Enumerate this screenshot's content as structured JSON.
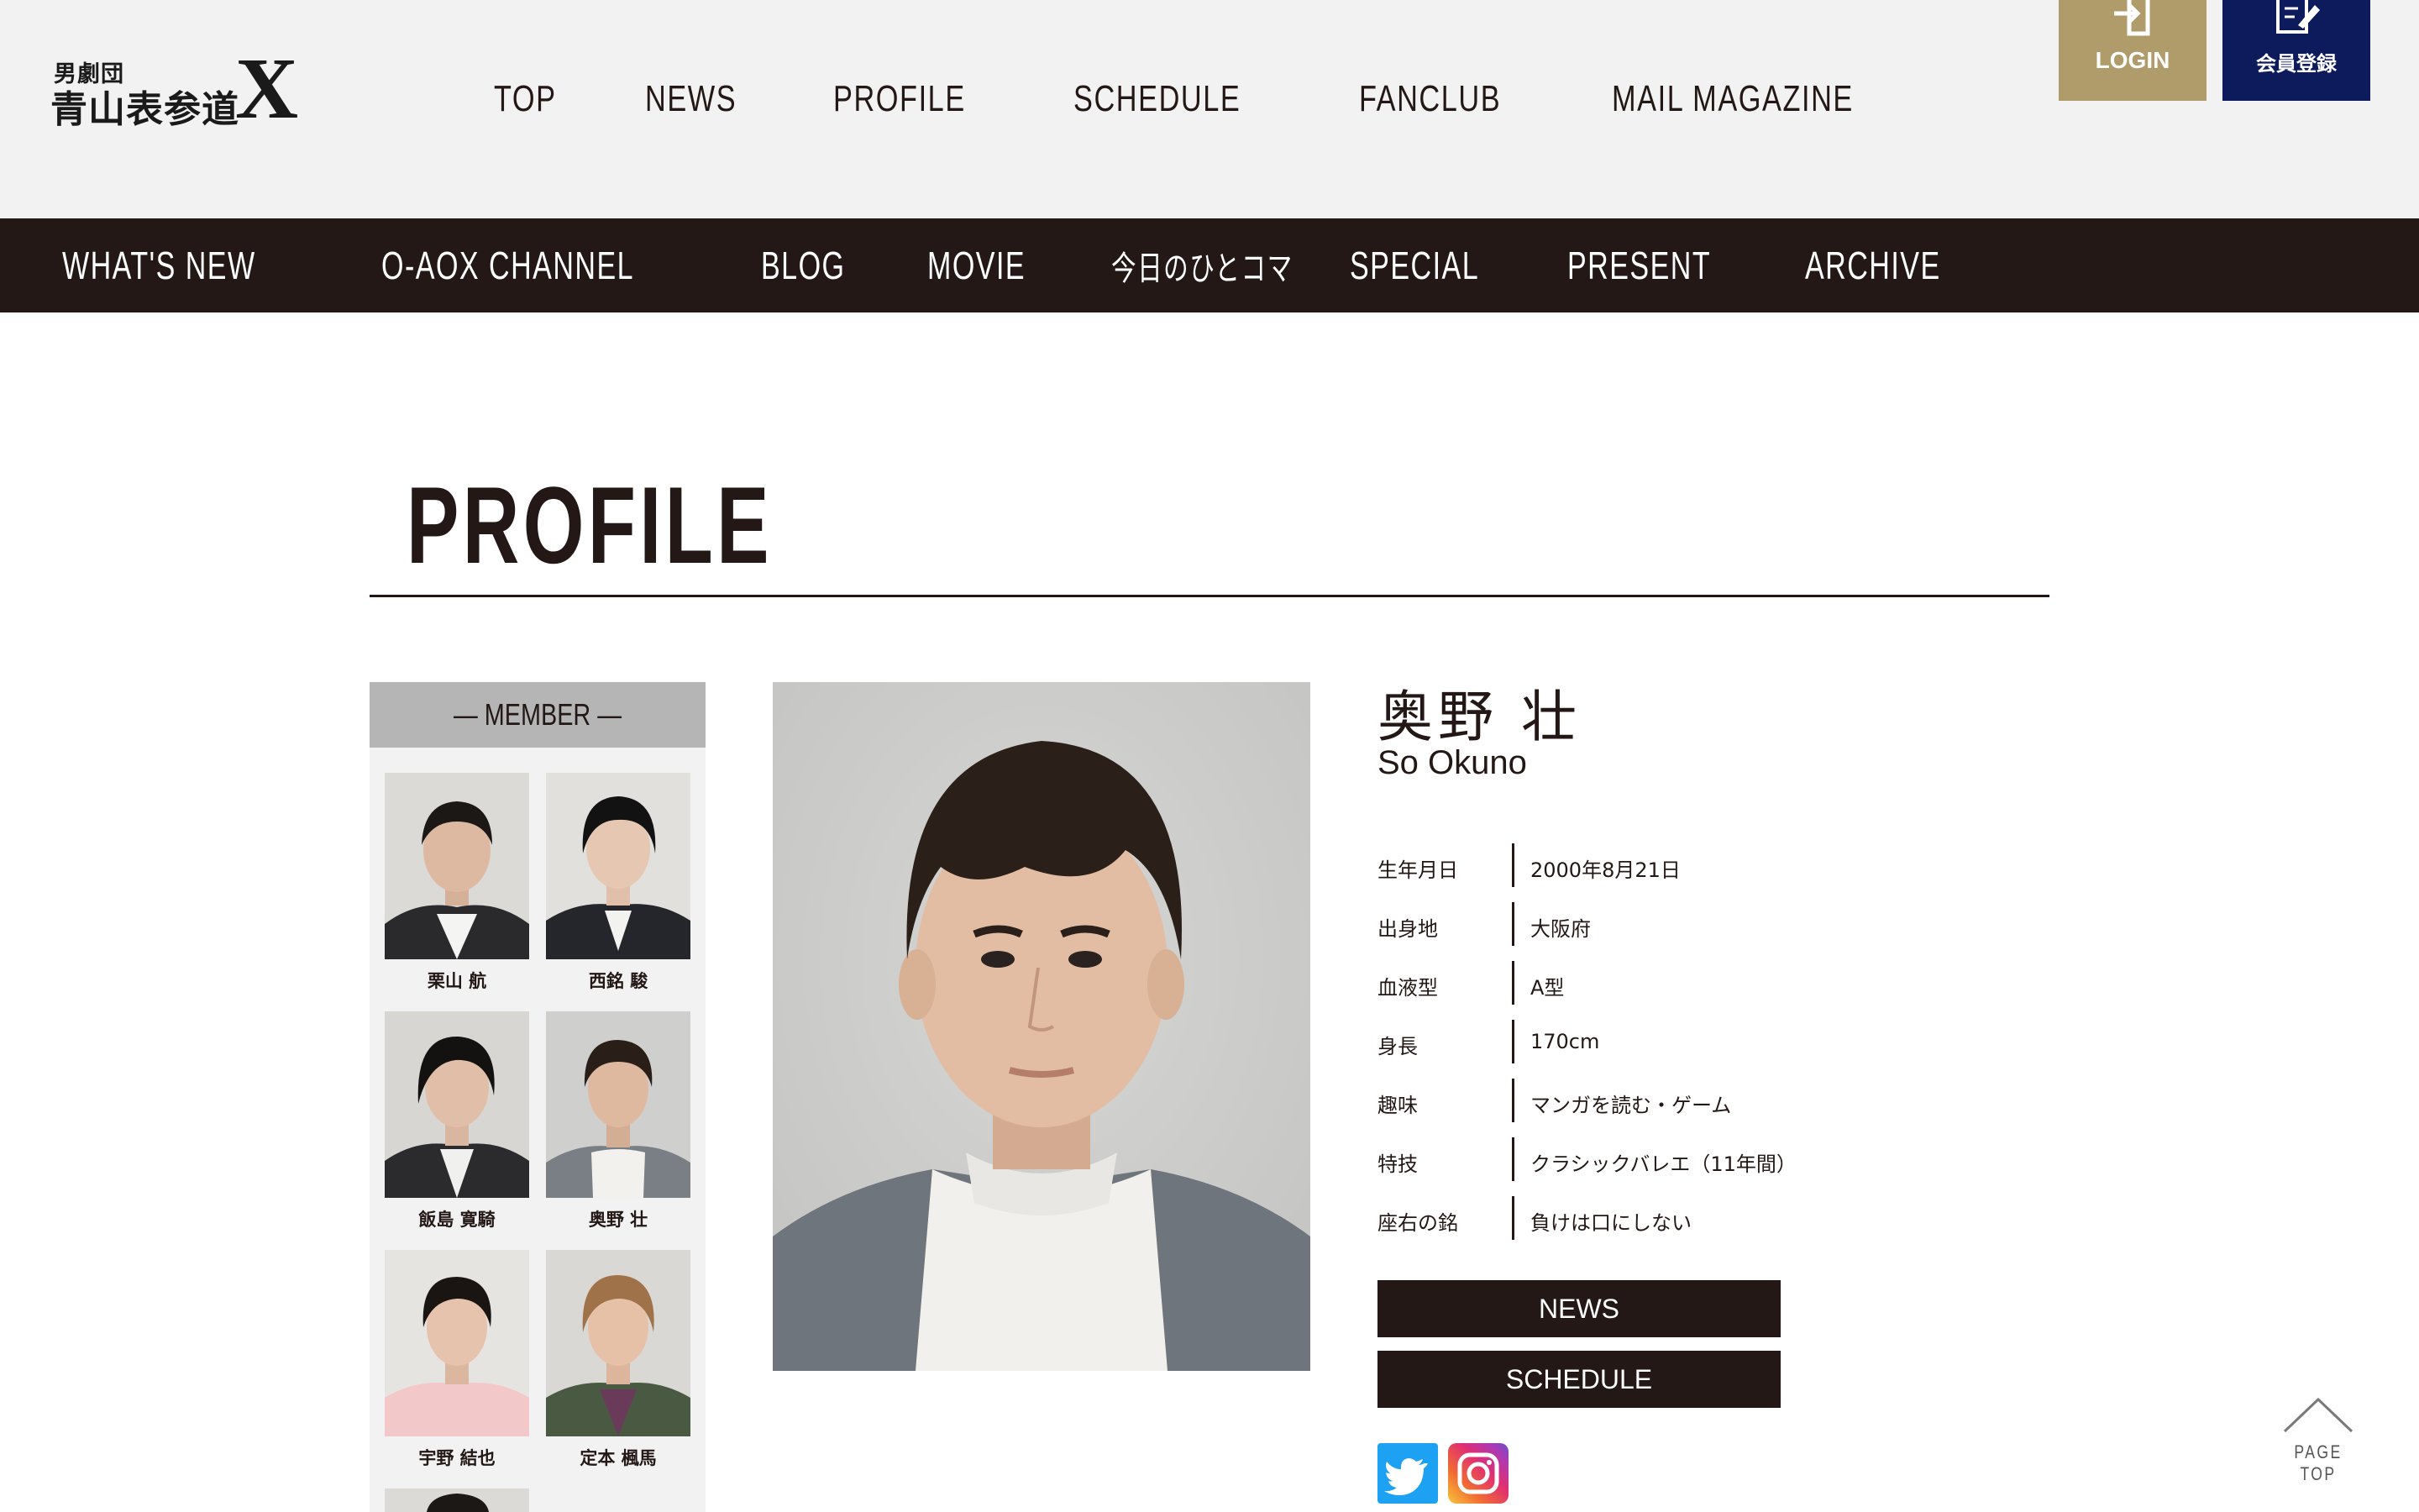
{
  "brand": {
    "logo_small": "男劇団",
    "logo_main": "青山表参道",
    "logo_x": "X"
  },
  "global_nav": [
    "TOP",
    "NEWS",
    "PROFILE",
    "SCHEDULE",
    "FANCLUB",
    "MAIL MAGAZINE"
  ],
  "header_buttons": {
    "login_label": "LOGIN",
    "register_label": "会員登録"
  },
  "sub_nav": [
    "WHAT'S NEW",
    "O-AOX CHANNEL",
    "BLOG",
    "MOVIE",
    "今日のひとコマ",
    "SPECIAL",
    "PRESENT",
    "ARCHIVE"
  ],
  "page_title": "PROFILE",
  "member_panel": {
    "heading": "— MEMBER —",
    "members": [
      {
        "name": "栗山 航"
      },
      {
        "name": "西銘 駿"
      },
      {
        "name": "飯島 寛騎"
      },
      {
        "name": "奥野 壮"
      },
      {
        "name": "宇野 結也"
      },
      {
        "name": "定本 楓馬"
      }
    ]
  },
  "profile": {
    "name_jp": "奥野 壮",
    "name_en": "So Okuno",
    "details": [
      {
        "label": "生年月日",
        "value": "2000年8月21日"
      },
      {
        "label": "出身地",
        "value": "大阪府"
      },
      {
        "label": "血液型",
        "value": "A型"
      },
      {
        "label": "身長",
        "value": "170cm"
      },
      {
        "label": "趣味",
        "value": "マンガを読む・ゲーム"
      },
      {
        "label": "特技",
        "value": "クラシックバレエ（11年間）"
      },
      {
        "label": "座右の銘",
        "value": "負けは口にしない"
      }
    ],
    "buttons": {
      "news": "NEWS",
      "schedule": "SCHEDULE"
    }
  },
  "page_top_label": "PAGE TOP",
  "colors": {
    "header_bg": "#f2f2f2",
    "dark": "#231815",
    "gold": "#b09b6b",
    "navy": "#0d1a5c",
    "twitter": "#1da1f2"
  },
  "icons": [
    "login-icon",
    "register-icon",
    "twitter-icon",
    "instagram-icon",
    "chevron-up-icon"
  ]
}
